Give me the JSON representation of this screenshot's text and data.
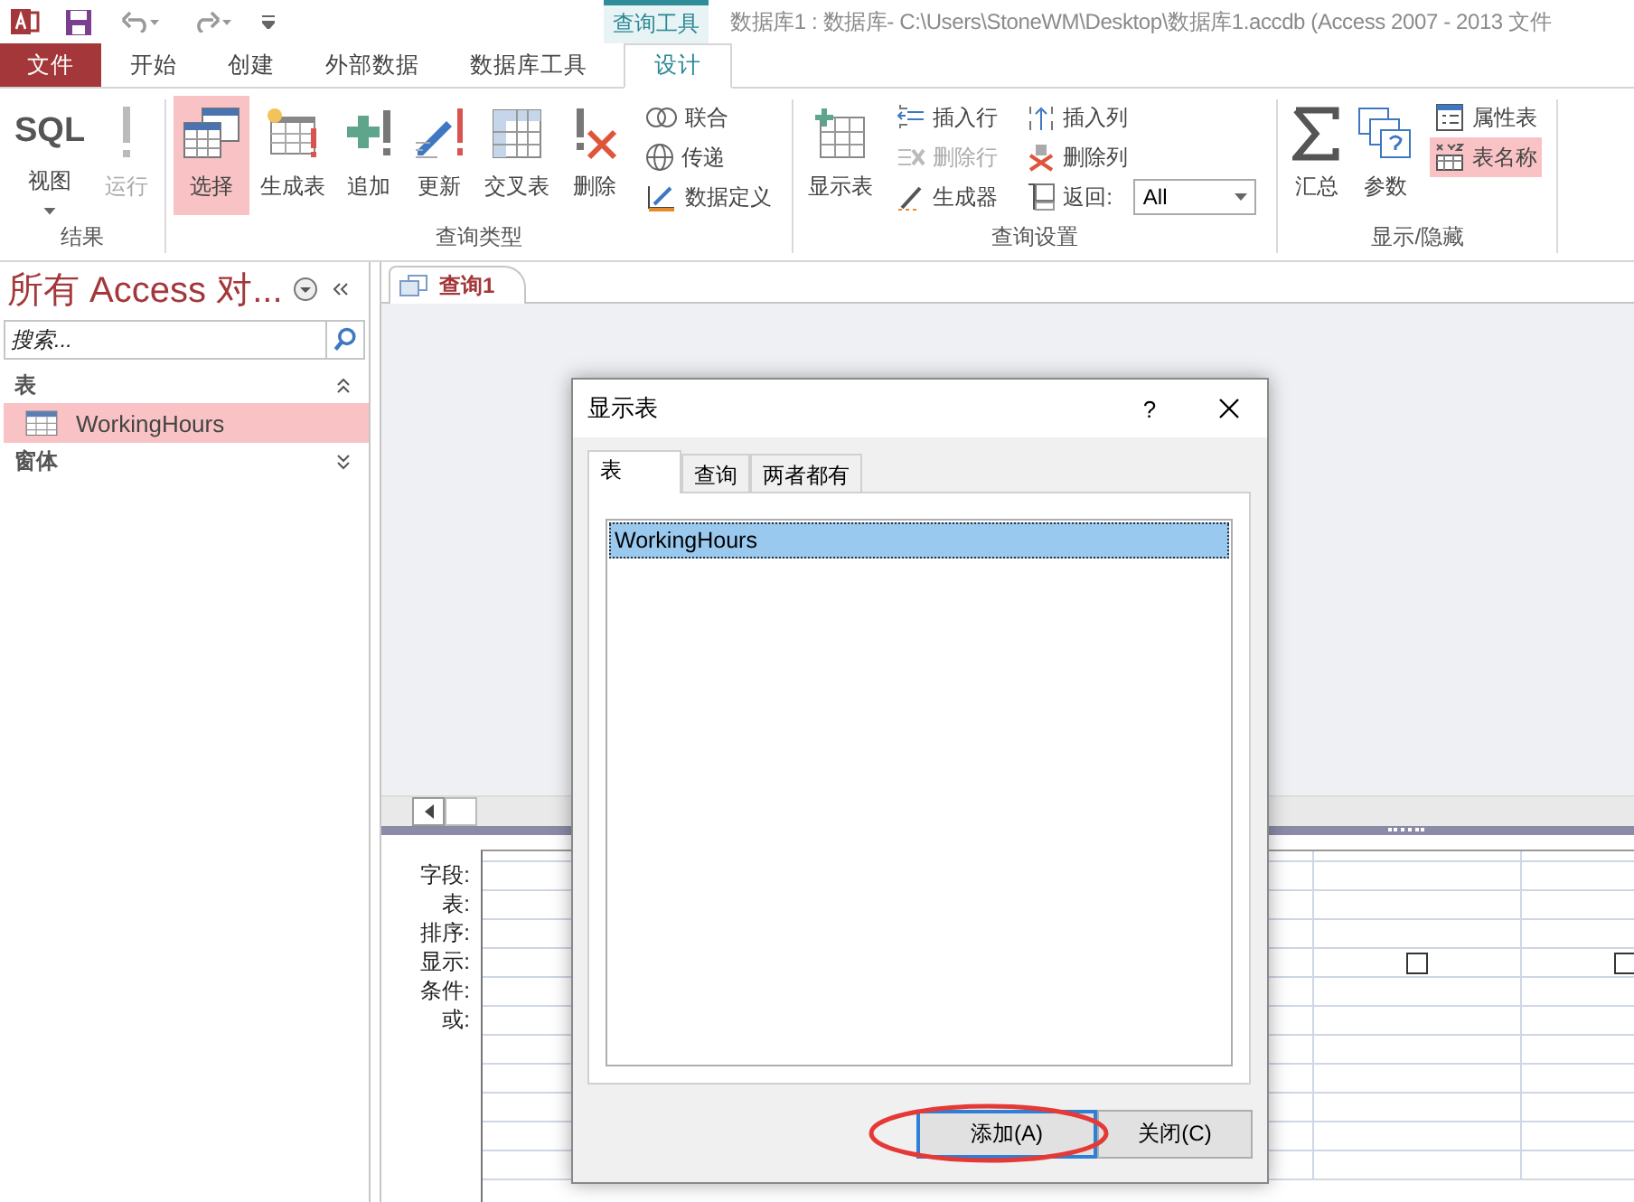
{
  "title_bar": {
    "context_label": "查询工具",
    "title": "数据库1 : 数据库- C:\\Users\\StoneWM\\Desktop\\数据库1.accdb (Access 2007 - 2013 文件"
  },
  "menu_tabs": [
    {
      "label": "文件",
      "kind": "file",
      "selected": false
    },
    {
      "label": "开始",
      "kind": "normal",
      "selected": false
    },
    {
      "label": "创建",
      "kind": "normal",
      "selected": false
    },
    {
      "label": "外部数据",
      "kind": "normal",
      "selected": false
    },
    {
      "label": "数据库工具",
      "kind": "normal",
      "selected": false
    },
    {
      "label": "设计",
      "kind": "contextual",
      "selected": true
    }
  ],
  "ribbon": {
    "groups": [
      {
        "label": "结果",
        "items": [
          {
            "kind": "large",
            "label": "视图",
            "icon_text": "SQL",
            "dropdown": true,
            "selected": false,
            "disabled": false
          },
          {
            "kind": "large",
            "label": "运行",
            "selected": false,
            "disabled": true
          }
        ]
      },
      {
        "label": "查询类型",
        "items": [
          {
            "kind": "large",
            "label": "选择",
            "selected": true,
            "disabled": false
          },
          {
            "kind": "large",
            "label": "生成表",
            "selected": false,
            "disabled": false
          },
          {
            "kind": "large",
            "label": "追加",
            "selected": false,
            "disabled": false
          },
          {
            "kind": "large",
            "label": "更新",
            "selected": false,
            "disabled": false
          },
          {
            "kind": "large",
            "label": "交叉表",
            "selected": false,
            "disabled": false
          },
          {
            "kind": "large",
            "label": "删除",
            "selected": false,
            "disabled": false
          },
          {
            "kind": "stack",
            "items": [
              {
                "kind": "button",
                "label": "联合",
                "selected": false,
                "disabled": false
              },
              {
                "kind": "button",
                "label": "传递",
                "selected": false,
                "disabled": false
              },
              {
                "kind": "button",
                "label": "数据定义",
                "selected": false,
                "disabled": false
              }
            ]
          }
        ]
      },
      {
        "label": "查询设置",
        "items": [
          {
            "kind": "large",
            "label": "显示表",
            "selected": false,
            "disabled": false
          },
          {
            "kind": "stack",
            "items": [
              {
                "kind": "button",
                "label": "插入行",
                "selected": false,
                "disabled": false
              },
              {
                "kind": "button",
                "label": "删除行",
                "selected": false,
                "disabled": true
              },
              {
                "kind": "button",
                "label": "生成器",
                "selected": false,
                "disabled": false
              }
            ]
          },
          {
            "kind": "stack",
            "items": [
              {
                "kind": "button",
                "label": "插入列",
                "selected": false,
                "disabled": false
              },
              {
                "kind": "button",
                "label": "删除列",
                "selected": false,
                "disabled": false
              },
              {
                "kind": "combo",
                "label": "返回:",
                "value": "All",
                "selected": false,
                "disabled": false
              }
            ]
          }
        ]
      },
      {
        "label": "显示/隐藏",
        "items": [
          {
            "kind": "large",
            "label": "汇总",
            "selected": false,
            "disabled": false
          },
          {
            "kind": "large",
            "label": "参数",
            "selected": false,
            "disabled": false
          },
          {
            "kind": "stack",
            "items": [
              {
                "kind": "button",
                "label": "属性表",
                "selected": false,
                "disabled": false
              },
              {
                "kind": "button",
                "label": "表名称",
                "selected": true,
                "disabled": false
              }
            ]
          }
        ]
      }
    ]
  },
  "nav_pane": {
    "title": "所有 Access 对...",
    "search": {
      "placeholder": "搜索..."
    },
    "groups": [
      {
        "label": "表",
        "expanded": true,
        "items": [
          {
            "label": "WorkingHours",
            "selected": true
          }
        ]
      },
      {
        "label": "窗体",
        "expanded": false
      }
    ]
  },
  "document_tabs": [
    {
      "label": "查询1",
      "selected": true
    }
  ],
  "grid": {
    "row_labels": [
      "字段:",
      "表:",
      "排序:",
      "显示:",
      "条件:",
      "或:"
    ],
    "show_checkboxes": [
      {
        "checked": false
      },
      {
        "checked": false
      }
    ]
  },
  "dialog": {
    "title": "显示表",
    "help": "?",
    "tabs": [
      {
        "label": "表",
        "selected": true
      },
      {
        "label": "查询",
        "selected": false
      },
      {
        "label": "两者都有",
        "selected": false
      }
    ],
    "items": [
      {
        "label": "WorkingHours",
        "selected": true
      }
    ],
    "buttons": [
      {
        "label": "添加(A)",
        "default": true
      },
      {
        "label": "关闭(C)",
        "default": false
      }
    ]
  }
}
